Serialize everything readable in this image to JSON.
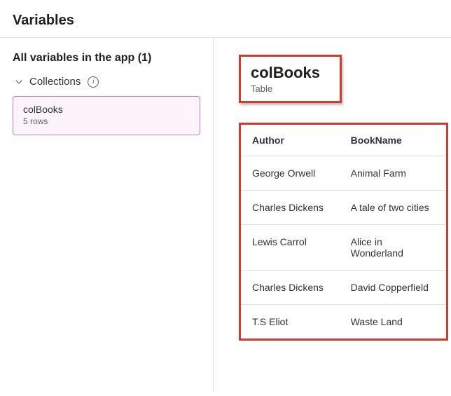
{
  "page": {
    "title": "Variables"
  },
  "sidebar": {
    "title": "All variables in the app (1)",
    "section": {
      "label": "Collections"
    },
    "collection_card": {
      "name": "colBooks",
      "rows": "5 rows"
    }
  },
  "detail": {
    "name": "colBooks",
    "type": "Table",
    "columns": {
      "author": "Author",
      "bookname": "BookName"
    },
    "rows": [
      {
        "author": "George Orwell",
        "bookname": "Animal Farm"
      },
      {
        "author": "Charles Dickens",
        "bookname": "A tale of two cities"
      },
      {
        "author": "Lewis Carrol",
        "bookname": "Alice in Wonderland"
      },
      {
        "author": "Charles Dickens",
        "bookname": "David Copperfield"
      },
      {
        "author": "T.S Eliot",
        "bookname": "Waste Land"
      }
    ]
  },
  "annotations": {
    "highlight_color": "#d13a2f"
  }
}
